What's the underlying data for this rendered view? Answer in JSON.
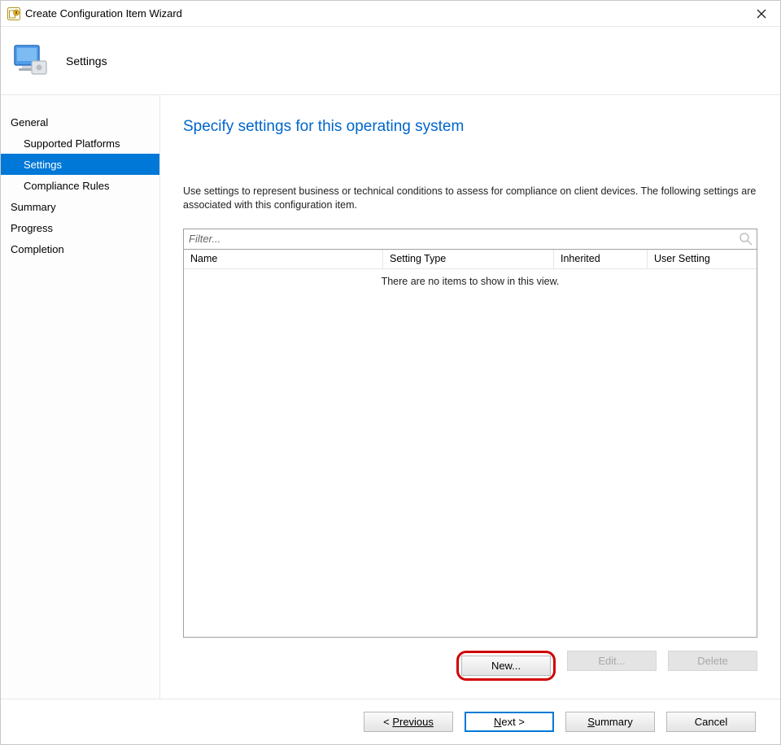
{
  "window": {
    "title": "Create Configuration Item Wizard"
  },
  "banner": {
    "label": "Settings"
  },
  "sidebar": {
    "items": [
      {
        "label": "General",
        "sub": false,
        "active": false
      },
      {
        "label": "Supported Platforms",
        "sub": true,
        "active": false
      },
      {
        "label": "Settings",
        "sub": true,
        "active": true
      },
      {
        "label": "Compliance Rules",
        "sub": true,
        "active": false
      },
      {
        "label": "Summary",
        "sub": false,
        "active": false
      },
      {
        "label": "Progress",
        "sub": false,
        "active": false
      },
      {
        "label": "Completion",
        "sub": false,
        "active": false
      }
    ]
  },
  "main": {
    "heading": "Specify settings for this operating system",
    "description": "Use settings to represent business or technical conditions to assess for compliance on client devices. The following settings are associated with this configuration item.",
    "filter_placeholder": "Filter...",
    "columns": [
      "Name",
      "Setting Type",
      "Inherited",
      "User Setting"
    ],
    "empty_message": "There are no items to show in this view.",
    "buttons": {
      "new": "New...",
      "edit": "Edit...",
      "delete": "Delete"
    }
  },
  "footer": {
    "previous": "Previous",
    "next": "Next >",
    "summary": "Summary",
    "cancel": "Cancel"
  }
}
